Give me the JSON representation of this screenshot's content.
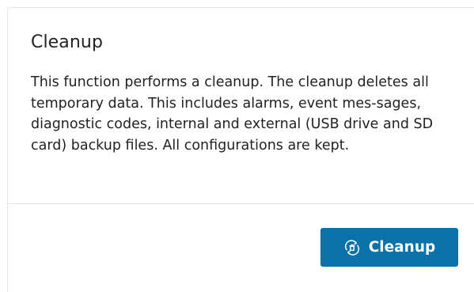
{
  "panel": {
    "title": "Cleanup",
    "description": "This function performs a cleanup. The cleanup deletes all temporary data. This includes alarms, event mes-sages, diagnostic codes, internal and external (USB drive and SD card) backup files. All configurations are kept."
  },
  "actions": {
    "cleanup_button_label": "Cleanup",
    "cleanup_button_icon": "cleanup-icon"
  },
  "colors": {
    "primary": "#0a72a8",
    "text": "#222222",
    "divider": "#e3e6e8"
  }
}
